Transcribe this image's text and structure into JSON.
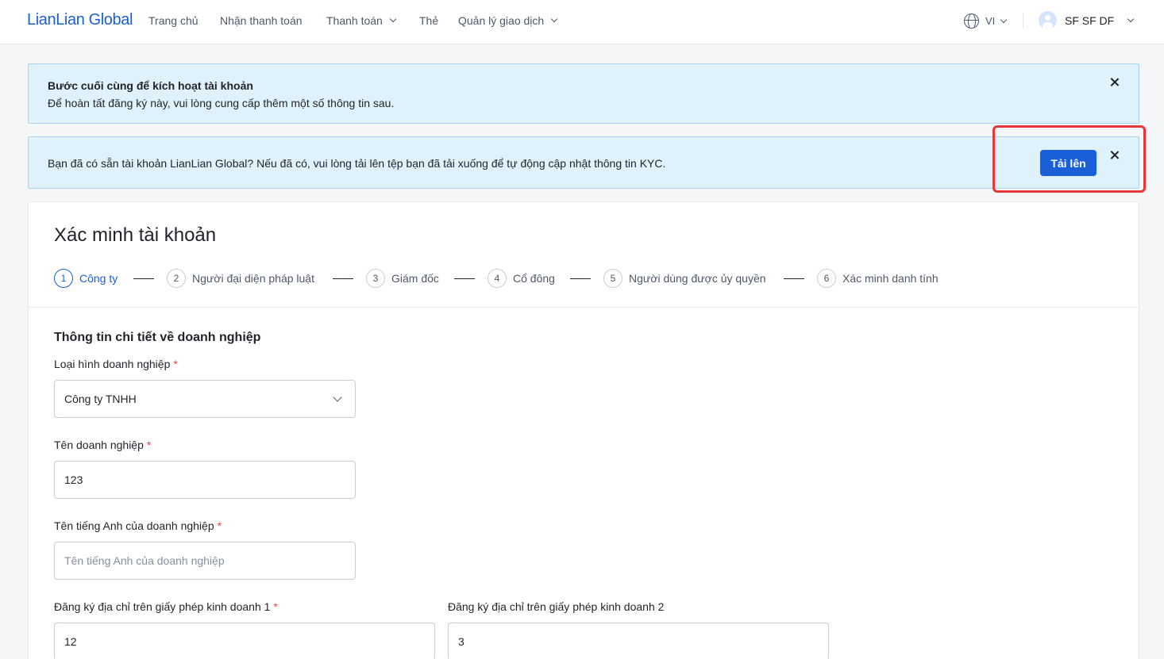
{
  "nav": {
    "logo": "LianLian Global",
    "items": [
      {
        "label": "Trang chủ"
      },
      {
        "label": "Nhận thanh toán"
      },
      {
        "label": "Thanh toán"
      },
      {
        "label": "Thẻ"
      },
      {
        "label": "Quản lý giao dịch"
      }
    ],
    "language": "VI",
    "user_name": "SF SF DF"
  },
  "banner_activate": {
    "title": "Bước cuối cùng để kích hoạt tài khoản",
    "text": "Để hoàn tất đăng ký này, vui lòng cung cấp thêm một số thông tin sau."
  },
  "banner_upload": {
    "text": "Bạn đã có sẵn tài khoản LianLian Global? Nếu đã có, vui lòng tải lên tệp bạn đã tải xuống để tự động cập nhật thông tin KYC.",
    "button": "Tải lên"
  },
  "page": {
    "title": "Xác minh tài khoản",
    "steps": [
      {
        "num": "1",
        "label": "Công ty"
      },
      {
        "num": "2",
        "label": "Người đại diện pháp luật"
      },
      {
        "num": "3",
        "label": "Giám đốc"
      },
      {
        "num": "4",
        "label": "Cổ đông"
      },
      {
        "num": "5",
        "label": "Người dùng được ủy quyền"
      },
      {
        "num": "6",
        "label": "Xác minh danh tính"
      }
    ]
  },
  "form": {
    "section_title": "Thông tin chi tiết về doanh nghiệp",
    "business_type": {
      "label": "Loại hình doanh nghiệp",
      "value": "Công ty TNHH"
    },
    "business_name": {
      "label": "Tên doanh nghiệp",
      "value": "123"
    },
    "english_name": {
      "label": "Tên tiếng Anh của doanh nghiệp",
      "placeholder": "Tên tiếng Anh của doanh nghiệp"
    },
    "address1": {
      "label": "Đăng ký địa chỉ trên giấy phép kinh doanh 1",
      "value": "12"
    },
    "address2": {
      "label": "Đăng ký địa chỉ trên giấy phép kinh doanh 2",
      "value": "3"
    }
  },
  "colors": {
    "brand": "#1a5fd8",
    "banner_bg": "#dff1fb",
    "highlight": "#e8373a",
    "required": "#f53f3f"
  }
}
